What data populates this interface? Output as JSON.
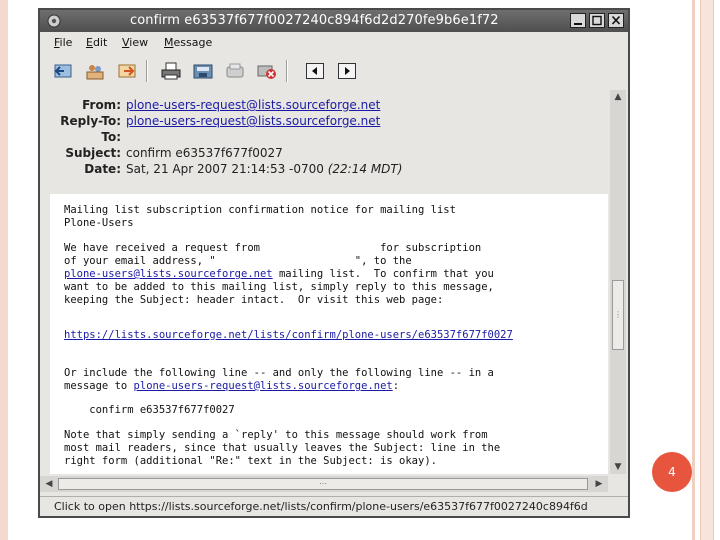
{
  "window": {
    "title": "confirm e63537f677f0027240c894f6d2d270fe9b6e1f72",
    "controls": {
      "minimize": "✕",
      "maximize": "□",
      "close": "✕"
    }
  },
  "menu": [
    {
      "key": "F",
      "rest": "ile"
    },
    {
      "key": "E",
      "rest": "dit"
    },
    {
      "key": "V",
      "rest": "iew"
    },
    {
      "key": "M",
      "rest": "essage"
    }
  ],
  "toolbar_icons": [
    "reply-icon",
    "reply-all-icon",
    "forward-icon",
    "print-icon",
    "save-icon",
    "save-attachments-icon",
    "delete-icon",
    "previous-icon",
    "next-icon"
  ],
  "headers": {
    "from_label": "From:",
    "from_value": "plone-users-request@lists.sourceforge.net",
    "replyto_label": "Reply-To:",
    "replyto_value": "plone-users-request@lists.sourceforge.net",
    "to_label": "To:",
    "to_value": "",
    "subject_label": "Subject:",
    "subject_value": "confirm e63537f677f0027",
    "date_label": "Date:",
    "date_value": "Sat, 21 Apr 2007 21:14:53 -0700",
    "date_local": "(22:14 MDT)"
  },
  "body": {
    "l1": "Mailing list subscription confirmation notice for mailing list",
    "l2": "Plone-Users",
    "l3": "We have received a request from                   for subscription",
    "l4": "of your email address, \"                      \", to the",
    "l5_link": "plone-users@lists.sourceforge.net",
    "l5_rest": " mailing list.  To confirm that you",
    "l6": "want to be added to this mailing list, simply reply to this message,",
    "l7": "keeping the Subject: header intact.  Or visit this web page:",
    "l8_link": "https://lists.sourceforge.net/lists/confirm/plone-users/e63537f677f0027",
    "l9": "Or include the following line -- and only the following line -- in a",
    "l10_prefix": "message to ",
    "l10_link": "plone-users-request@lists.sourceforge.net",
    "l10_suffix": ":",
    "l11": "    confirm e63537f677f0027",
    "l12": "Note that simply sending a `reply' to this message should work from",
    "l13": "most mail readers, since that usually leaves the Subject: line in the",
    "l14": "right form (additional \"Re:\" text in the Subject: is okay)."
  },
  "status": {
    "text": "Click to open https://lists.sourceforge.net/lists/confirm/plone-users/e63537f677f0027240c894f6d"
  },
  "slide": {
    "page_number": "4"
  },
  "colors": {
    "link": "#1a1aa6",
    "badge": "#e8553f",
    "titlebar": "#5a5a5a"
  }
}
